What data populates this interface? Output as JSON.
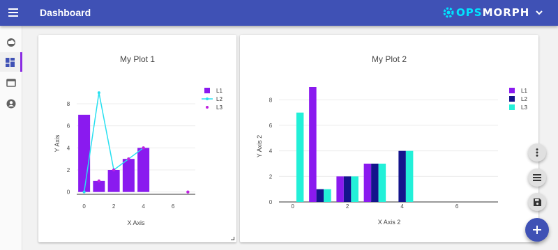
{
  "header": {
    "title": "Dashboard",
    "brand_ops": "OPS",
    "brand_morph": "MORPH"
  },
  "colors": {
    "primary": "#3f51b5",
    "purple": "#8a1aef",
    "navy": "#14148c",
    "cyan": "#22f0d8",
    "lineCyan": "#27e0f0",
    "active": "#8a2be2"
  },
  "sidebar": {
    "items": [
      {
        "icon": "cloud-icon"
      },
      {
        "icon": "dashboard-icon",
        "active": true
      },
      {
        "icon": "window-icon"
      },
      {
        "icon": "account-circle-icon"
      }
    ]
  },
  "chart_data": [
    {
      "type": "bar",
      "title": "My Plot 1",
      "xlabel": "X Axis",
      "ylabel": "Y Axis",
      "xlim": [
        -0.5,
        7.5
      ],
      "ylim": [
        -0.4,
        9.2
      ],
      "xticks": [
        0,
        2,
        4,
        6
      ],
      "yticks": [
        0,
        2,
        4,
        6,
        8
      ],
      "grid": "horizontal",
      "legend": "top-right",
      "series": [
        {
          "name": "L1",
          "kind": "bar",
          "x": [
            0,
            1,
            2,
            3,
            4
          ],
          "values": [
            7,
            1,
            2,
            3,
            4
          ]
        },
        {
          "name": "L2",
          "kind": "line",
          "x": [
            0,
            1,
            2,
            3,
            4
          ],
          "values": [
            0,
            9,
            2,
            3,
            4
          ]
        },
        {
          "name": "L3",
          "kind": "scatter",
          "x": [
            1,
            2,
            3,
            4,
            7
          ],
          "values": [
            1,
            2,
            3,
            4,
            0
          ]
        }
      ]
    },
    {
      "type": "bar",
      "title": "My Plot 2",
      "xlabel": "X Axis 2",
      "ylabel": "Y Axis 2",
      "xlim": [
        -0.5,
        7.5
      ],
      "ylim": [
        0,
        9
      ],
      "xticks": [
        0,
        2,
        4,
        6
      ],
      "yticks": [
        0,
        2,
        4,
        6,
        8
      ],
      "grid": "horizontal",
      "legend": "top-right",
      "categories": [
        0,
        1,
        2,
        3,
        4
      ],
      "series": [
        {
          "name": "L1",
          "values": [
            0,
            9,
            2,
            3,
            0
          ]
        },
        {
          "name": "L2",
          "values": [
            0,
            1,
            2,
            3,
            4
          ]
        },
        {
          "name": "L3",
          "values": [
            7,
            1,
            2,
            3,
            4
          ]
        }
      ]
    }
  ]
}
